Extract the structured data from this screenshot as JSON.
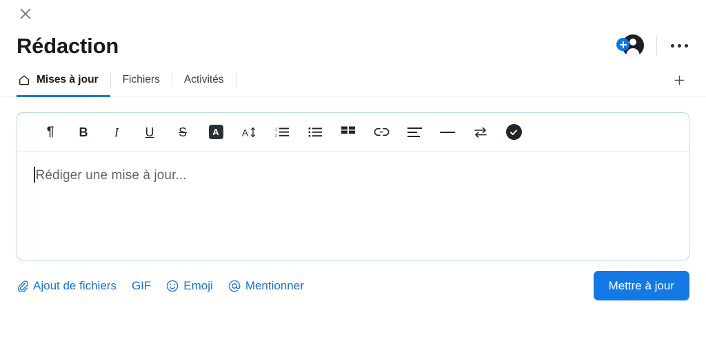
{
  "header": {
    "close_icon": "close-icon",
    "title": "Rédaction",
    "add_member_icon": "add-person-icon",
    "more_icon": "more-options-icon"
  },
  "tabs": {
    "items": [
      {
        "label": "Mises à jour",
        "icon": "home-icon",
        "active": true
      },
      {
        "label": "Fichiers",
        "icon": "",
        "active": false
      },
      {
        "label": "Activités",
        "icon": "",
        "active": false
      }
    ],
    "add_tab_icon": "plus-icon"
  },
  "composer": {
    "toolbar": [
      {
        "name": "paragraph-format-button",
        "glyph": "¶",
        "kind": "pilcrow",
        "title": "Paragraphe"
      },
      {
        "name": "bold-button",
        "glyph": "B",
        "kind": "bold",
        "title": "Gras"
      },
      {
        "name": "italic-button",
        "glyph": "I",
        "kind": "italic",
        "title": "Italique"
      },
      {
        "name": "underline-button",
        "glyph": "U",
        "kind": "under",
        "title": "Souligné"
      },
      {
        "name": "strikethrough-button",
        "glyph": "S",
        "kind": "strike",
        "title": "Barré"
      },
      {
        "name": "text-highlight-button",
        "glyph": "A",
        "kind": "chip",
        "title": "Couleur du texte"
      },
      {
        "name": "font-size-button",
        "glyph": "A",
        "kind": "fontsize",
        "title": "Taille du texte"
      },
      {
        "name": "ordered-list-button",
        "glyph": "",
        "kind": "ordered-list",
        "title": "Liste numérotée"
      },
      {
        "name": "bulleted-list-button",
        "glyph": "",
        "kind": "bullet-list",
        "title": "Liste à puces"
      },
      {
        "name": "table-button",
        "glyph": "",
        "kind": "table",
        "title": "Tableau"
      },
      {
        "name": "link-button",
        "glyph": "",
        "kind": "link",
        "title": "Lien"
      },
      {
        "name": "align-text-button",
        "glyph": "",
        "kind": "align",
        "title": "Alignement"
      },
      {
        "name": "horizontal-rule-button",
        "glyph": "",
        "kind": "rule",
        "title": "Ligne horizontale"
      },
      {
        "name": "swap-arrows-button",
        "glyph": "",
        "kind": "swap",
        "title": "Permuter"
      },
      {
        "name": "check-circle-button",
        "glyph": "",
        "kind": "check",
        "title": "Terminé"
      }
    ],
    "placeholder": "Rédiger une mise à jour..."
  },
  "footer": {
    "links": [
      {
        "label": "Ajout de fichiers",
        "icon": "paperclip-icon"
      },
      {
        "label": "GIF",
        "icon": ""
      },
      {
        "label": "Emoji",
        "icon": "smiley-icon"
      },
      {
        "label": "Mentionner",
        "icon": "at-sign-icon"
      }
    ],
    "submit_label": "Mettre à jour"
  },
  "colors": {
    "accent_blue": "#1479e4",
    "link_blue": "#1773d6",
    "tab_underline": "#1775e0",
    "composer_border": "#b6d4ef",
    "divider": "#e3e5e8"
  }
}
